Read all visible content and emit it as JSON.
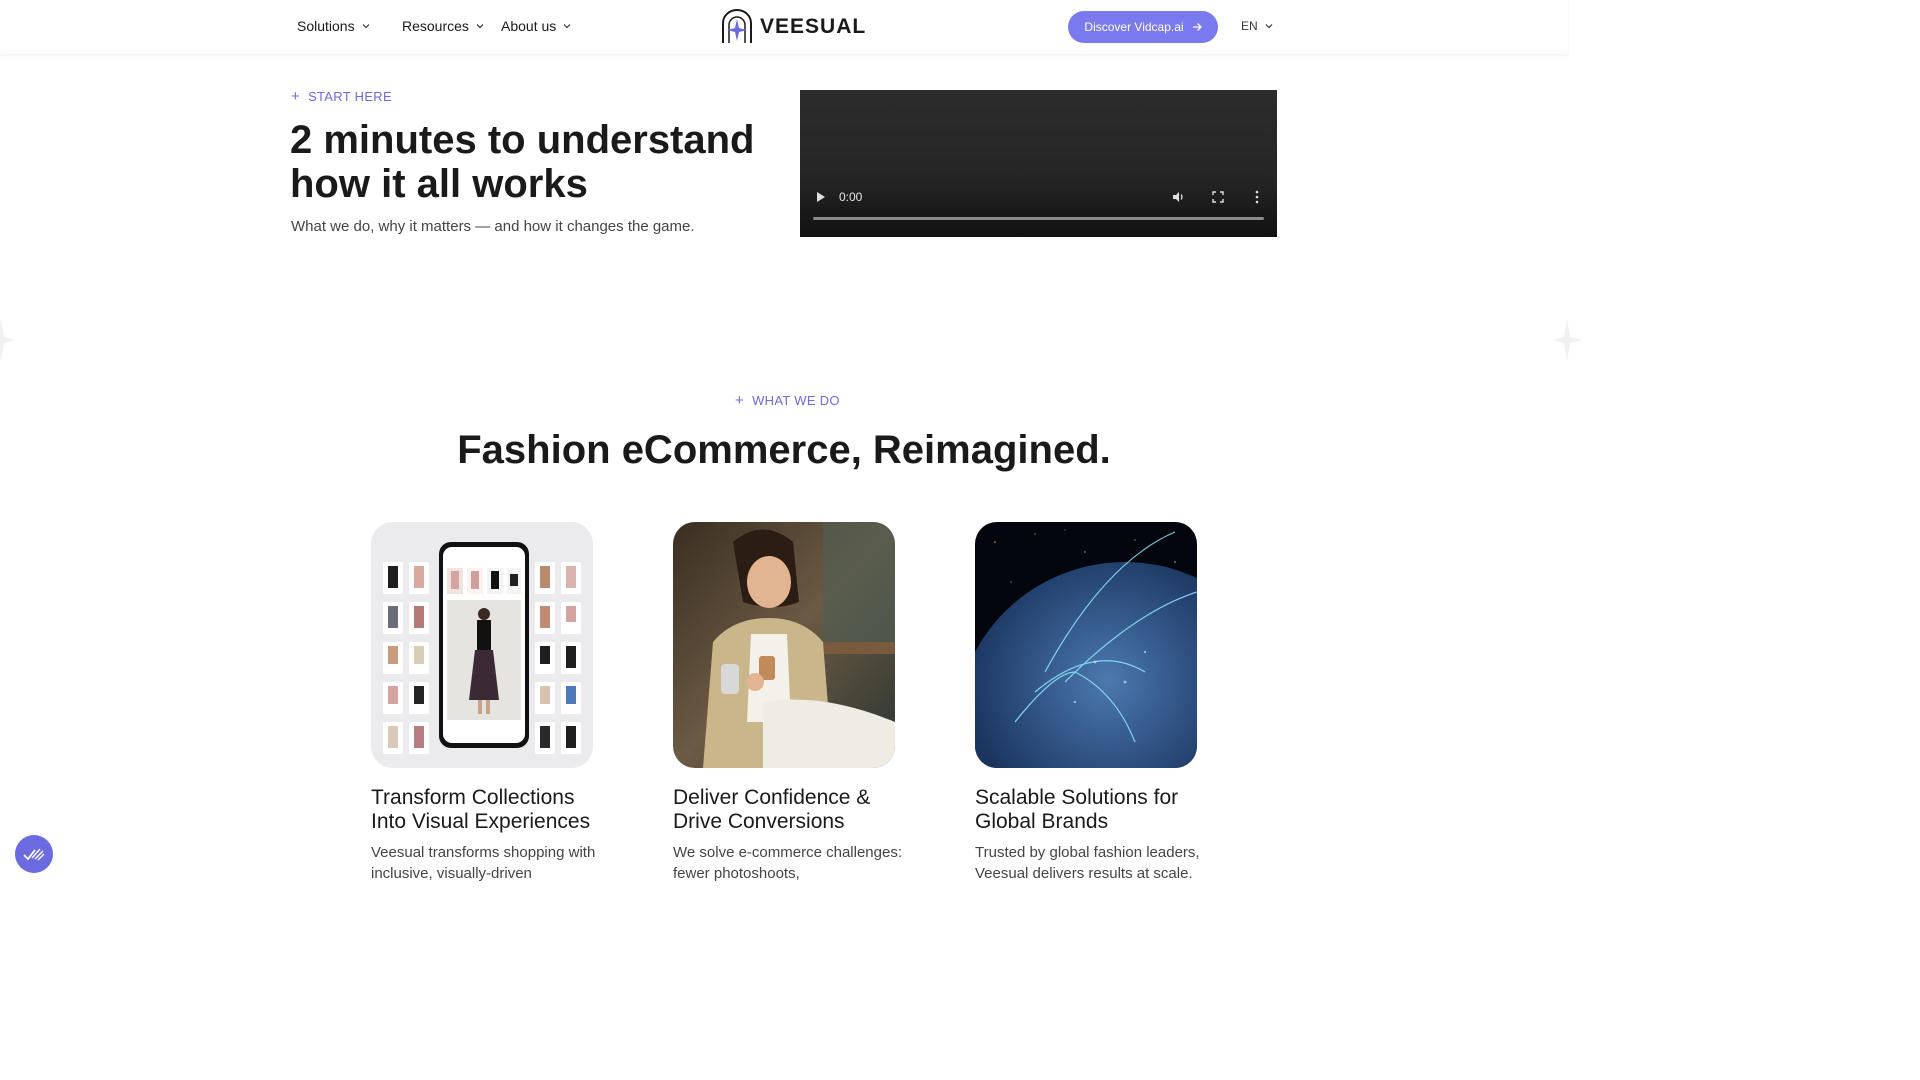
{
  "header": {
    "nav": [
      {
        "label": "Solutions"
      },
      {
        "label": "Resources"
      },
      {
        "label": "About us"
      }
    ],
    "brand": "VEESUAL",
    "cta_label": "Discover Vidcap.ai",
    "lang": "EN"
  },
  "intro": {
    "eyebrow": "START HERE",
    "title": "2 minutes to understand how it all works",
    "subtitle": "What we do, why it matters — and how it changes the game.",
    "video": {
      "time": "0:00",
      "progress": 0
    }
  },
  "what_we_do": {
    "eyebrow": "WHAT WE DO",
    "title": "Fashion eCommerce, Reimagined.",
    "cards": [
      {
        "title": "Transform Collections Into Visual Experiences",
        "desc": "Veesual transforms shopping with inclusive, visually-driven"
      },
      {
        "title": "Deliver Confidence & Drive Conversions",
        "desc": "We solve e-commerce challenges: fewer photoshoots,"
      },
      {
        "title": "Scalable Solutions for Global Brands",
        "desc": "Trusted by global fashion leaders, Veesual delivers results at scale."
      }
    ]
  },
  "colors": {
    "accent": "#7b79ee",
    "eyebrow": "#6c6ae0",
    "text": "#1a1a1a"
  }
}
